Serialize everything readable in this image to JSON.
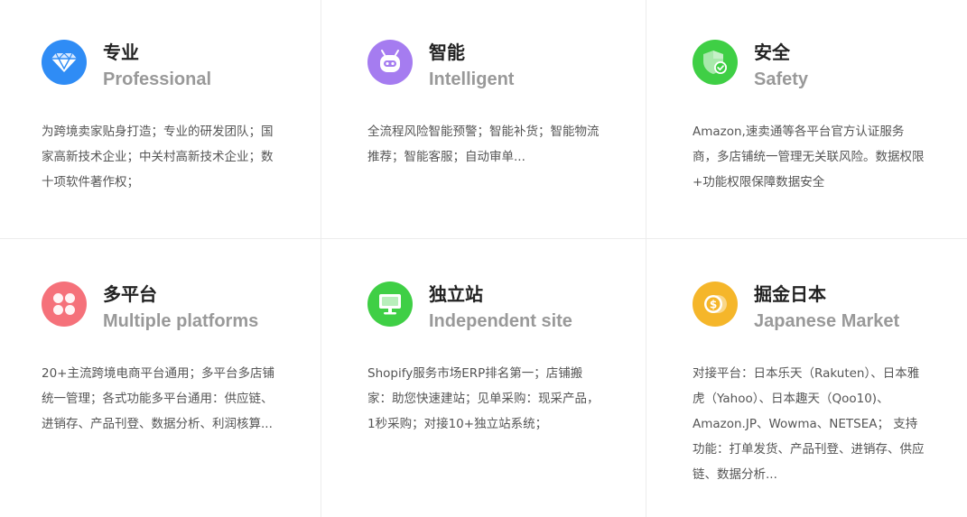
{
  "features": [
    {
      "title": "专业",
      "subtitle": "Professional",
      "description": "为跨境卖家贴身打造；专业的研发团队；国家高新技术企业；中关村高新技术企业；数十项软件著作权；",
      "icon": "diamond-icon",
      "color": "#2f8cf5"
    },
    {
      "title": "智能",
      "subtitle": "Intelligent",
      "description": "全流程风险智能预警；智能补货；智能物流推荐；智能客服；自动审单...",
      "icon": "robot-icon",
      "color": "#a57cf0"
    },
    {
      "title": "安全",
      "subtitle": "Safety",
      "description": "Amazon,速卖通等各平台官方认证服务商，多店铺统一管理无关联风险。数据权限+功能权限保障数据安全",
      "icon": "shield-check-icon",
      "color": "#3fcf45"
    },
    {
      "title": "多平台",
      "subtitle": "Multiple platforms",
      "description": "20+主流跨境电商平台通用；多平台多店铺统一管理；各式功能多平台通用：供应链、进销存、产品刊登、数据分析、利润核算...",
      "icon": "clover-icon",
      "color": "#f5717a"
    },
    {
      "title": "独立站",
      "subtitle": "Independent site",
      "description": "Shopify服务市场ERP排名第一；店铺搬家：助您快速建站；见单采购：现采产品，1秒采购；对接10+独立站系统；",
      "icon": "monitor-icon",
      "color": "#3fcf45"
    },
    {
      "title": "掘金日本",
      "subtitle": "Japanese Market",
      "description": "对接平台：日本乐天（Rakuten）、日本雅虎（Yahoo）、日本趣天（Qoo10)、Amazon.JP、Wowma、NETSEA； 支持功能：打单发货、产品刊登、进销存、供应链、数据分析...",
      "icon": "coin-icon",
      "color": "#f5b62a"
    }
  ]
}
